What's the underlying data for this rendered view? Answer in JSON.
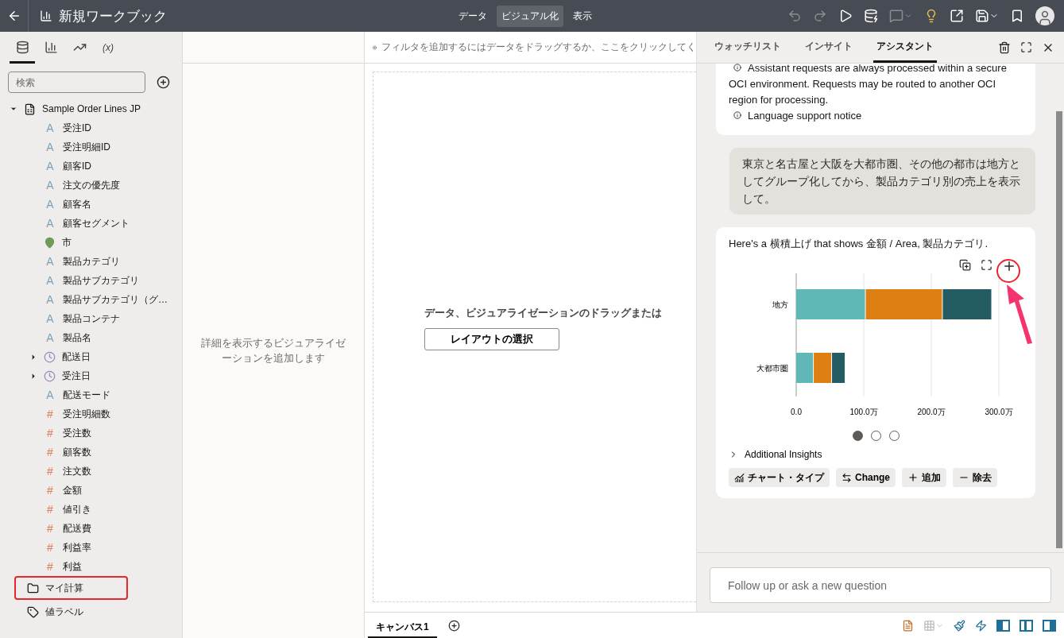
{
  "header": {
    "title": "新規ワークブック",
    "nav": [
      {
        "label": "データ",
        "selected": false
      },
      {
        "label": "ビジュアル化",
        "selected": true
      },
      {
        "label": "表示",
        "selected": false
      }
    ],
    "toolbar": [
      {
        "kind": "undo",
        "disabled": true
      },
      {
        "kind": "redo",
        "disabled": true
      },
      {
        "kind": "play",
        "disabled": false
      },
      {
        "kind": "refresh",
        "disabled": false
      },
      {
        "kind": "comment",
        "disabled": true
      },
      {
        "kind": "bulb",
        "disabled": false
      },
      {
        "kind": "export",
        "disabled": false
      },
      {
        "kind": "save",
        "disabled": false
      },
      {
        "kind": "bookmark",
        "disabled": false
      },
      {
        "kind": "avatar"
      }
    ]
  },
  "data_panel": {
    "tabs": [
      {
        "kind": "data",
        "selected": true
      },
      {
        "kind": "viz",
        "selected": false
      },
      {
        "kind": "analytics",
        "selected": false
      },
      {
        "kind": "variables",
        "text": "(x)",
        "selected": false
      }
    ],
    "search": {
      "placeholder": "検索"
    },
    "tree": [
      {
        "kind": "dataset",
        "label": "Sample Order Lines JP",
        "expanded": true,
        "children": [
          {
            "kind": "attribute",
            "icon": "A",
            "label": "受注ID"
          },
          {
            "kind": "attribute",
            "icon": "A",
            "label": "受注明細ID"
          },
          {
            "kind": "attribute",
            "icon": "A",
            "label": "顧客ID"
          },
          {
            "kind": "attribute",
            "icon": "A",
            "label": "注文の優先度"
          },
          {
            "kind": "attribute",
            "icon": "A",
            "label": "顧客名"
          },
          {
            "kind": "attribute",
            "icon": "A",
            "label": "顧客セグメント"
          },
          {
            "kind": "geo",
            "label": "市"
          },
          {
            "kind": "attribute",
            "icon": "A",
            "label": "製品カテゴリ"
          },
          {
            "kind": "attribute",
            "icon": "A",
            "label": "製品サブカテゴリ"
          },
          {
            "kind": "attribute",
            "icon": "A",
            "label": "製品サブカテゴリ（グ…"
          },
          {
            "kind": "attribute",
            "icon": "A",
            "label": "製品コンテナ"
          },
          {
            "kind": "attribute",
            "icon": "A",
            "label": "製品名"
          },
          {
            "kind": "date",
            "label": "配送日",
            "expanded": false
          },
          {
            "kind": "date",
            "label": "受注日",
            "expanded": false
          },
          {
            "kind": "attribute",
            "icon": "A",
            "label": "配送モード"
          },
          {
            "kind": "measure",
            "icon": "#",
            "label": "受注明細数"
          },
          {
            "kind": "measure",
            "icon": "#",
            "label": "受注数"
          },
          {
            "kind": "measure",
            "icon": "#",
            "label": "顧客数"
          },
          {
            "kind": "measure",
            "icon": "#",
            "label": "注文数"
          },
          {
            "kind": "measure",
            "icon": "#",
            "label": "金額"
          },
          {
            "kind": "measure",
            "icon": "#",
            "label": "値引き"
          },
          {
            "kind": "measure",
            "icon": "#",
            "label": "配送費"
          },
          {
            "kind": "measure",
            "icon": "#",
            "label": "利益率"
          },
          {
            "kind": "measure",
            "icon": "#",
            "label": "利益"
          }
        ]
      },
      {
        "kind": "folder",
        "label": "マイ計算",
        "highlighted": true
      },
      {
        "kind": "tag",
        "label": "値ラベル",
        "highlighted": false
      }
    ]
  },
  "details_panel": {
    "text": "詳細を表示するビジュアライゼーションを追加します"
  },
  "filter_bar": {
    "text": "フィルタを追加するにはデータをドラッグするか、ここをクリックしてく"
  },
  "canvas": {
    "hint": "データ、ビジュアライゼーションのドラッグまたは",
    "button": "レイアウトの選択"
  },
  "canvas_tabs": [
    {
      "label": "キャンバス1",
      "selected": true
    }
  ],
  "assistant": {
    "tabs": [
      {
        "label": "ウォッチリスト",
        "selected": false
      },
      {
        "label": "インサイト",
        "selected": false
      },
      {
        "label": "アシスタント",
        "selected": true
      }
    ],
    "notices": [
      {
        "text": "Assistant requests are always processed within a secure OCI environment. Requests may be routed to another OCI region for processing."
      },
      {
        "text": "Language support notice"
      }
    ],
    "user_message": "東京と名古屋と大阪を大都市圏、その他の都市は地方としてグループ化してから、製品カテゴリ別の売上を表示して。",
    "response": {
      "text": "Here's a 横積上げ that shows 金額 / Area, 製品カテゴリ.",
      "add_highlighted": true,
      "chart_data": {
        "type": "bar",
        "orientation": "horizontal",
        "stacked": true,
        "categories": [
          "地方",
          "大都市圏"
        ],
        "series": [
          {
            "color": "#5fb8b5",
            "values": [
              103,
              26
            ]
          },
          {
            "color": "#dd7f13",
            "values": [
              114,
              27
            ]
          },
          {
            "color": "#245c64",
            "values": [
              73,
              20
            ]
          }
        ],
        "grid": true,
        "xlim": [
          0,
          300
        ],
        "xticks": [
          {
            "value": 0,
            "label": "0.0"
          },
          {
            "value": 100,
            "label": "100.0万"
          },
          {
            "value": 200,
            "label": "200.0万"
          },
          {
            "value": 300,
            "label": "300.0万"
          }
        ]
      },
      "pages": [
        {
          "selected": true
        },
        {
          "selected": false
        },
        {
          "selected": false
        }
      ],
      "insights": {
        "label": "Additional Insights",
        "expanded": false
      },
      "actions": [
        {
          "kind": "chart-type",
          "label": "チャート・タイプ"
        },
        {
          "kind": "change",
          "label": "Change"
        },
        {
          "kind": "add",
          "label": "追加"
        },
        {
          "kind": "remove",
          "label": "除去"
        }
      ]
    },
    "input": {
      "placeholder": "Follow up or ask a new question"
    }
  },
  "status_icons": [
    {
      "kind": "page",
      "disabled": false
    },
    {
      "kind": "grid",
      "disabled": true
    },
    {
      "kind": "brush",
      "disabled": false
    },
    {
      "kind": "bolt",
      "disabled": false
    }
  ],
  "layout_toggles": [
    {
      "kind": "left",
      "selected": true
    },
    {
      "kind": "center",
      "selected": true
    },
    {
      "kind": "right",
      "selected": true
    }
  ]
}
